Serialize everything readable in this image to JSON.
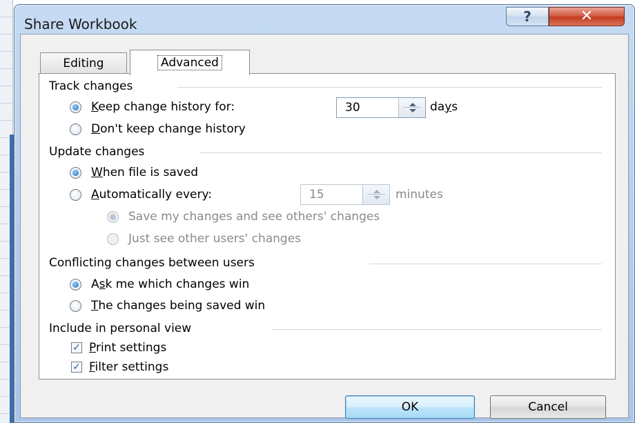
{
  "dialog": {
    "title": "Share Workbook",
    "help_glyph": "?",
    "close_glyph": "✕"
  },
  "tabs": [
    {
      "label": "Editing",
      "active": false
    },
    {
      "label": "Advanced",
      "active": true
    }
  ],
  "track_changes": {
    "header": "Track changes",
    "keep_history": {
      "label_pre": "",
      "label_key": "K",
      "label_rest": "eep change history for:",
      "checked": true
    },
    "days_value": "30",
    "days_unit_pre": "da",
    "days_unit_key": "y",
    "days_unit_rest": "s",
    "dont_keep": {
      "label_key": "D",
      "label_rest": "on't keep change history",
      "checked": false
    }
  },
  "update_changes": {
    "header": "Update changes",
    "when_saved": {
      "label_key": "W",
      "label_rest": "hen file is saved",
      "checked": true
    },
    "automatically": {
      "label_key": "A",
      "label_rest": "utomatically every:",
      "checked": false
    },
    "minutes_value": "15",
    "minutes_unit": "minutes",
    "save_mine": {
      "label": "Save my changes and see others' changes",
      "checked": true
    },
    "just_see": {
      "label": "Just see other users' changes",
      "checked": false
    }
  },
  "conflicting": {
    "header": "Conflicting changes between users",
    "ask_me": {
      "label_pre": "A",
      "label_key": "s",
      "label_rest": "k me which changes win",
      "checked": true
    },
    "being_saved": {
      "label_key": "T",
      "label_rest": "he changes being saved win",
      "checked": false
    }
  },
  "personal_view": {
    "header": "Include in personal view",
    "print_settings": {
      "label_key": "P",
      "label_rest": "rint settings",
      "checked": true
    },
    "filter_settings": {
      "label_key": "F",
      "label_rest": "ilter settings",
      "checked": true
    }
  },
  "buttons": {
    "ok": "OK",
    "cancel": "Cancel"
  },
  "colors": {
    "title_bar": "#b9d1ee",
    "close_button": "#c8452a",
    "radio_selected": "#1f6fbf",
    "default_button_border": "#3c7fb1"
  }
}
